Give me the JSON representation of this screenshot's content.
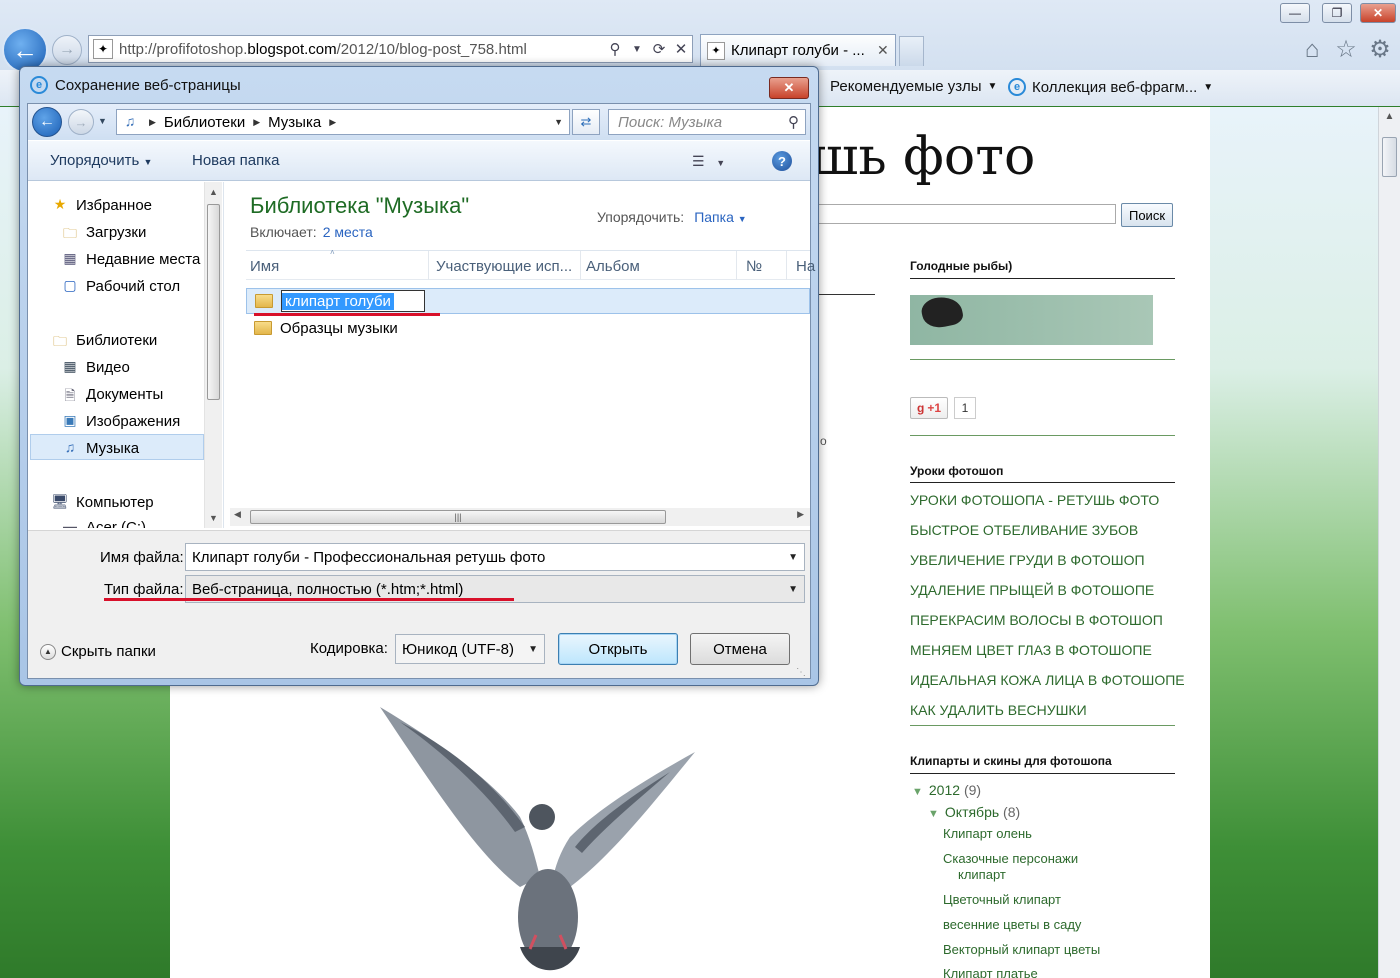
{
  "browser": {
    "url_prefix": "http://profifotoshop.",
    "url_domain": "blogspot.com",
    "url_path": "/2012/10/blog-post_758.html",
    "tab_title": "Клипарт голуби - ...",
    "favorites": [
      {
        "label": "Рекомендуемые узлы"
      },
      {
        "label": "Коллекция веб-фрагм..."
      }
    ]
  },
  "page": {
    "blog_title": "шь фото",
    "search_button": "Поиск",
    "stray_text": "о",
    "sidebar": {
      "hungry_fish_heading": "Голодные рыбы)",
      "gplus_label": "+1",
      "gplus_count": "1",
      "lessons_heading": "Уроки фотошоп",
      "lessons": [
        "УРОКИ ФОТОШОПА - РЕТУШЬ ФОТО",
        "БЫСТРОЕ ОТБЕЛИВАНИЕ ЗУБОВ",
        "УВЕЛИЧЕНИЕ ГРУДИ В ФОТОШОП",
        "УДАЛЕНИЕ ПРЫЩЕЙ В ФОТОШОПЕ",
        "ПЕРЕКРАСИМ ВОЛОСЫ В ФОТОШОП",
        "МЕНЯЕМ ЦВЕТ ГЛАЗ В ФОТОШОПЕ",
        "ИДЕАЛЬНАЯ КОЖА ЛИЦА В ФОТОШОПЕ",
        "КАК УДАЛИТЬ ВЕСНУШКИ"
      ],
      "clipart_heading": "Клипарты и скины для фотошопа",
      "archive": {
        "year": "2012",
        "year_count": "(9)",
        "month": "Октябрь",
        "month_count": "(8)",
        "posts": [
          "Клипарт олень",
          "Сказочные персонажи",
          "клипарт",
          "Цветочный клипарт",
          "весенние цветы в саду",
          "Векторный клипарт цветы",
          "Клипарт платье"
        ]
      }
    }
  },
  "dialog": {
    "title": "Сохранение веб-страницы",
    "breadcrumb": [
      "Библиотеки",
      "Музыка"
    ],
    "search_placeholder": "Поиск: Музыка",
    "organize": "Упорядочить",
    "new_folder": "Новая папка",
    "nav_tree": {
      "favorites": "Избранное",
      "downloads": "Загрузки",
      "recent": "Недавние места",
      "desktop": "Рабочий стол",
      "libraries": "Библиотеки",
      "video": "Видео",
      "documents": "Документы",
      "images": "Изображения",
      "music": "Музыка",
      "computer": "Компьютер",
      "drive": "Acer (C:)"
    },
    "library_title": "Библиотека \"Музыка\"",
    "includes_label": "Включает:",
    "includes_link": "2 места",
    "arrange_label": "Упорядочить:",
    "arrange_value": "Папка",
    "columns": [
      "Имя",
      "Участвующие исп...",
      "Альбом",
      "№",
      "На"
    ],
    "files": [
      {
        "name": "клипарт голуби"
      },
      {
        "name": "Образцы музыки"
      }
    ],
    "filename_label": "Имя файла:",
    "filename_value": "Клипарт голуби - Профессиональная ретушь фото",
    "filetype_label": "Тип файла:",
    "filetype_value": "Веб-страница, полностью (*.htm;*.html)",
    "encoding_label": "Кодировка:",
    "encoding_value": "Юникод (UTF-8)",
    "open_button": "Открыть",
    "cancel_button": "Отмена",
    "hide_folders": "Скрыть папки"
  },
  "colors": {
    "annotation_red": "#d8102a",
    "link_green": "#2d6a2d",
    "library_title_green": "#1e6b24",
    "selection_blue": "#3399ff"
  }
}
